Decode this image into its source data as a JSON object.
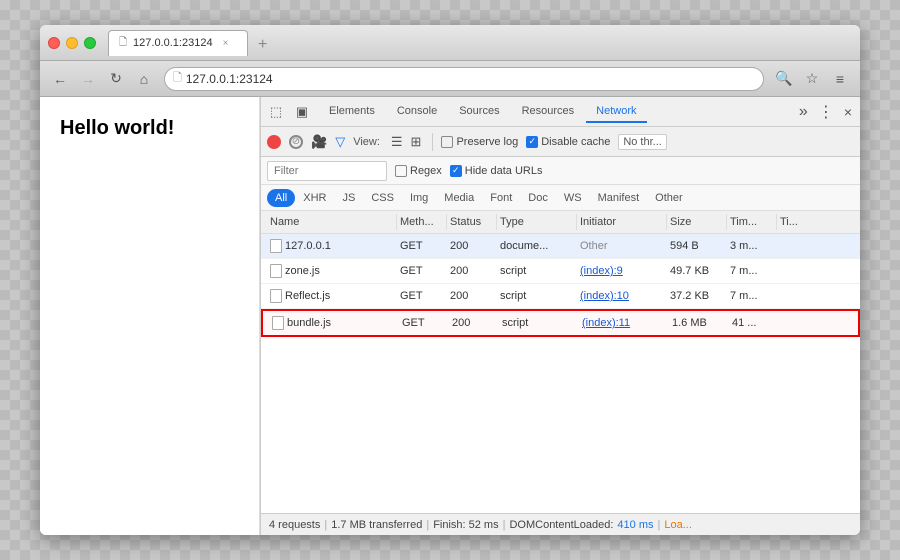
{
  "browser": {
    "tab": {
      "label": "127.0.0.1:23124",
      "close": "×"
    },
    "new_tab": "+",
    "nav": {
      "back": "←",
      "forward": "→",
      "refresh": "↻",
      "home": "⌂",
      "address": "127.0.0.1:23124",
      "address_icon": "🗋",
      "search_icon": "🔍",
      "star_icon": "☆",
      "menu_icon": "≡"
    }
  },
  "page": {
    "content": "Hello world!"
  },
  "devtools": {
    "tabs": [
      "Elements",
      "Console",
      "Sources",
      "Resources",
      "Network"
    ],
    "active_tab": "Network",
    "more_icon": "»",
    "settings_icon": "⋮",
    "close_icon": "×",
    "toolbar": {
      "record_title": "Record",
      "clear_title": "Clear",
      "camera_title": "Screenshots",
      "filter_title": "Filter",
      "view_label": "View:",
      "view_list": "☰",
      "view_group": "⊞",
      "preserve_log": "Preserve log",
      "disable_cache": "Disable cache",
      "disable_cache_checked": true,
      "preserve_log_checked": false,
      "no_throttle": "No thr..."
    },
    "filter_bar": {
      "placeholder": "Filter",
      "regex_label": "Regex",
      "hide_data_urls": "Hide data URLs",
      "hide_data_urls_checked": true
    },
    "type_tabs": [
      "All",
      "XHR",
      "JS",
      "CSS",
      "Img",
      "Media",
      "Font",
      "Doc",
      "WS",
      "Manifest",
      "Other"
    ],
    "active_type_tab": "All",
    "table": {
      "headers": [
        "Name",
        "Meth...",
        "Status",
        "Type",
        "Initiator",
        "Size",
        "Tim...",
        "Ti..."
      ],
      "rows": [
        {
          "name": "127.0.0.1",
          "method": "GET",
          "status": "200",
          "type": "docume...",
          "initiator": "Other",
          "size": "594 B",
          "time": "3 m...",
          "waterfall": "",
          "selected": true,
          "highlighted": false
        },
        {
          "name": "zone.js",
          "method": "GET",
          "status": "200",
          "type": "script",
          "initiator": "(index):9",
          "size": "49.7 KB",
          "time": "7 m...",
          "waterfall": "",
          "selected": false,
          "highlighted": false
        },
        {
          "name": "Reflect.js",
          "method": "GET",
          "status": "200",
          "type": "script",
          "initiator": "(index):10",
          "size": "37.2 KB",
          "time": "7 m...",
          "waterfall": "",
          "selected": false,
          "highlighted": false
        },
        {
          "name": "bundle.js",
          "method": "GET",
          "status": "200",
          "type": "script",
          "initiator": "(index):11",
          "size": "1.6 MB",
          "time": "41 ...",
          "waterfall": "",
          "selected": false,
          "highlighted": true
        }
      ]
    },
    "status_bar": {
      "requests": "4 requests",
      "sep1": "|",
      "transferred": "1.7 MB transferred",
      "sep2": "|",
      "finish": "Finish: 52 ms",
      "sep3": "|",
      "dom_content_loaded_label": "DOMContentLoaded:",
      "dom_content_loaded_value": "410 ms",
      "sep4": "|",
      "load_label": "Loa..."
    }
  }
}
